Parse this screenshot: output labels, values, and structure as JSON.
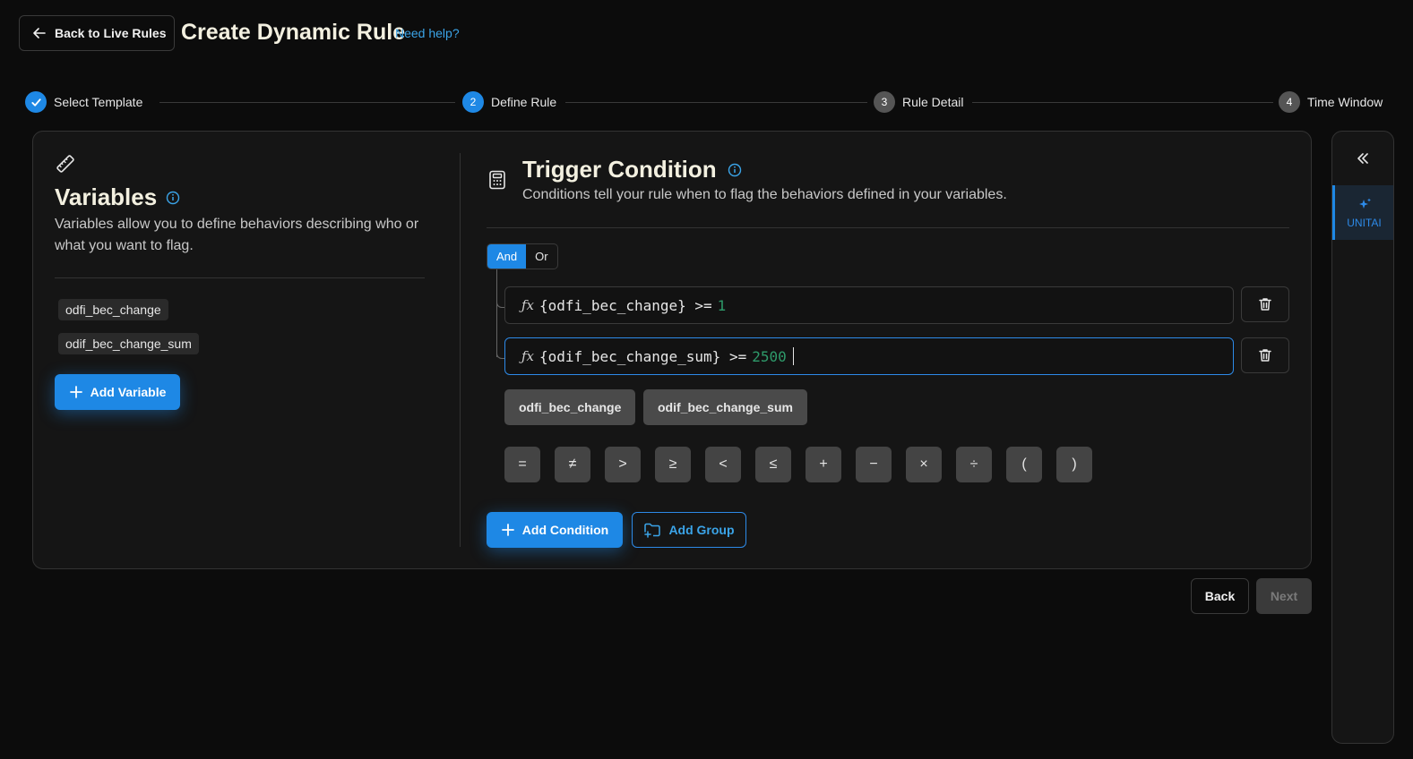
{
  "header": {
    "back_label": "Back to Live Rules",
    "title": "Create Dynamic Rule",
    "help_link": "Need help?"
  },
  "stepper": {
    "steps": [
      {
        "number": "1",
        "label": "Select Template",
        "state": "complete"
      },
      {
        "number": "2",
        "label": "Define Rule",
        "state": "active"
      },
      {
        "number": "3",
        "label": "Rule Detail",
        "state": "pending"
      },
      {
        "number": "4",
        "label": "Time Window",
        "state": "pending"
      }
    ]
  },
  "variables": {
    "title": "Variables",
    "description": "Variables allow you to define behaviors describing who or what you want to flag.",
    "items": [
      "odfi_bec_change",
      "odif_bec_change_sum"
    ],
    "add_label": "Add Variable"
  },
  "trigger": {
    "title": "Trigger Condition",
    "description": "Conditions tell your rule when to flag the behaviors defined in your variables.",
    "logic": {
      "and": "And",
      "or": "Or",
      "selected": "And"
    },
    "conditions": [
      {
        "expr": "{odfi_bec_change} >=",
        "value": "1",
        "focused": false
      },
      {
        "expr": "{odif_bec_change_sum} >=",
        "value": "2500",
        "focused": true
      }
    ],
    "suggestions": [
      "odfi_bec_change",
      "odif_bec_change_sum"
    ],
    "operators": [
      "=",
      "≠",
      ">",
      "≥",
      "<",
      "≤",
      "+",
      "−",
      "×",
      "÷",
      "(",
      ")"
    ],
    "add_condition_label": "Add Condition",
    "add_group_label": "Add Group"
  },
  "footer": {
    "back_label": "Back",
    "next_label": "Next"
  },
  "side_panel": {
    "tab_label": "UNITAI"
  },
  "colors": {
    "accent": "#1e88e5",
    "link": "#3ba4e8",
    "value_number": "#2e9a6a",
    "background": "#0c0c0c",
    "panel": "#151515"
  }
}
